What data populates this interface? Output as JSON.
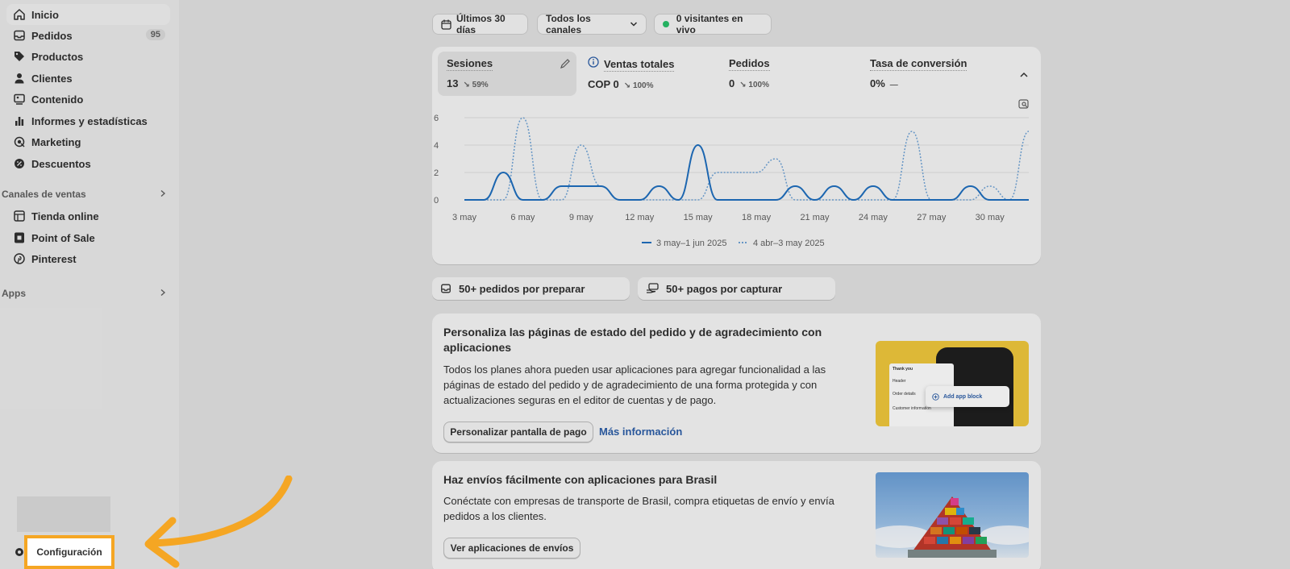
{
  "sidebar": {
    "items": [
      {
        "label": "Inicio",
        "icon": "home-icon"
      },
      {
        "label": "Pedidos",
        "icon": "inbox-icon",
        "badge": "95"
      },
      {
        "label": "Productos",
        "icon": "tag-icon"
      },
      {
        "label": "Clientes",
        "icon": "person-icon"
      },
      {
        "label": "Contenido",
        "icon": "content-icon"
      },
      {
        "label": "Informes y estadísticas",
        "icon": "bar-chart-icon"
      },
      {
        "label": "Marketing",
        "icon": "target-icon"
      },
      {
        "label": "Descuentos",
        "icon": "discount-icon"
      }
    ],
    "sales_channels_label": "Canales de ventas",
    "channels": [
      {
        "label": "Tienda online",
        "icon": "store-icon"
      },
      {
        "label": "Point of Sale",
        "icon": "pos-icon"
      },
      {
        "label": "Pinterest",
        "icon": "pinterest-icon"
      }
    ],
    "apps_label": "Apps",
    "settings_label": "Configuración"
  },
  "filters": {
    "date_range": "Últimos 30 días",
    "channels": "Todos los canales",
    "live_visitors": "0 visitantes en vivo"
  },
  "metrics": [
    {
      "label": "Sesiones",
      "value": "13",
      "delta": "↘ 59%"
    },
    {
      "label": "Ventas totales",
      "value": "COP 0",
      "delta": "↘ 100%"
    },
    {
      "label": "Pedidos",
      "value": "0",
      "delta": "↘ 100%"
    },
    {
      "label": "Tasa de conversión",
      "value": "0%",
      "delta": "—"
    }
  ],
  "chart_data": {
    "type": "line",
    "x": [
      "3 may",
      "4 may",
      "5 may",
      "6 may",
      "7 may",
      "8 may",
      "9 may",
      "10 may",
      "11 may",
      "12 may",
      "13 may",
      "14 may",
      "15 may",
      "16 may",
      "17 may",
      "18 may",
      "19 may",
      "20 may",
      "21 may",
      "22 may",
      "23 may",
      "24 may",
      "25 may",
      "26 may",
      "27 may",
      "28 may",
      "29 may",
      "30 may",
      "31 may",
      "1 jun"
    ],
    "xticks": [
      "3 may",
      "6 may",
      "9 may",
      "12 may",
      "15 may",
      "18 may",
      "21 may",
      "24 may",
      "27 may",
      "30 may"
    ],
    "yticks": [
      "0",
      "2",
      "4",
      "6"
    ],
    "ylim": [
      0,
      6
    ],
    "series": [
      {
        "name": "3 may–1 jun 2025",
        "style": "solid",
        "color": "#1f6fbf",
        "values": [
          0,
          0,
          2,
          0,
          0,
          1,
          1,
          1,
          0,
          0,
          1,
          0,
          4,
          0,
          0,
          0,
          0,
          1,
          0,
          1,
          0,
          1,
          0,
          0,
          0,
          0,
          1,
          0,
          0,
          0
        ]
      },
      {
        "name": "4 abr–3 may 2025",
        "style": "dotted",
        "color": "#6fa3d6",
        "values": [
          0,
          0,
          0,
          6,
          0,
          0,
          4,
          1,
          0,
          0,
          0,
          0,
          0,
          2,
          2,
          2,
          3,
          0,
          0,
          0,
          0,
          0,
          0,
          5,
          0,
          0,
          0,
          1,
          0,
          5
        ]
      }
    ]
  },
  "action_pills": [
    {
      "label": "50+ pedidos por preparar",
      "icon": "inbox-icon"
    },
    {
      "label": "50+ pagos por capturar",
      "icon": "hand-cash-icon"
    }
  ],
  "promo1": {
    "title": "Personaliza las páginas de estado del pedido y de agradecimiento con aplicaciones",
    "body": "Todos los planes ahora pueden usar aplicaciones para agregar funcionalidad a las páginas de estado del pedido y de agradecimiento de una forma protegida y con actualizaciones seguras en el editor de cuentas y de pago.",
    "button": "Personalizar pantalla de pago",
    "link": "Más información",
    "image_add_block": "Add app block",
    "image_thank_you": "Thank you",
    "image_header": "Header",
    "image_order_details": "Order details",
    "image_customer_information": "Customer information"
  },
  "promo2": {
    "title": "Haz envíos fácilmente con aplicaciones para Brasil",
    "body": "Conéctate con empresas de transporte de Brasil, compra etiquetas de envío y envía pedidos a los clientes.",
    "button": "Ver aplicaciones de envíos"
  }
}
